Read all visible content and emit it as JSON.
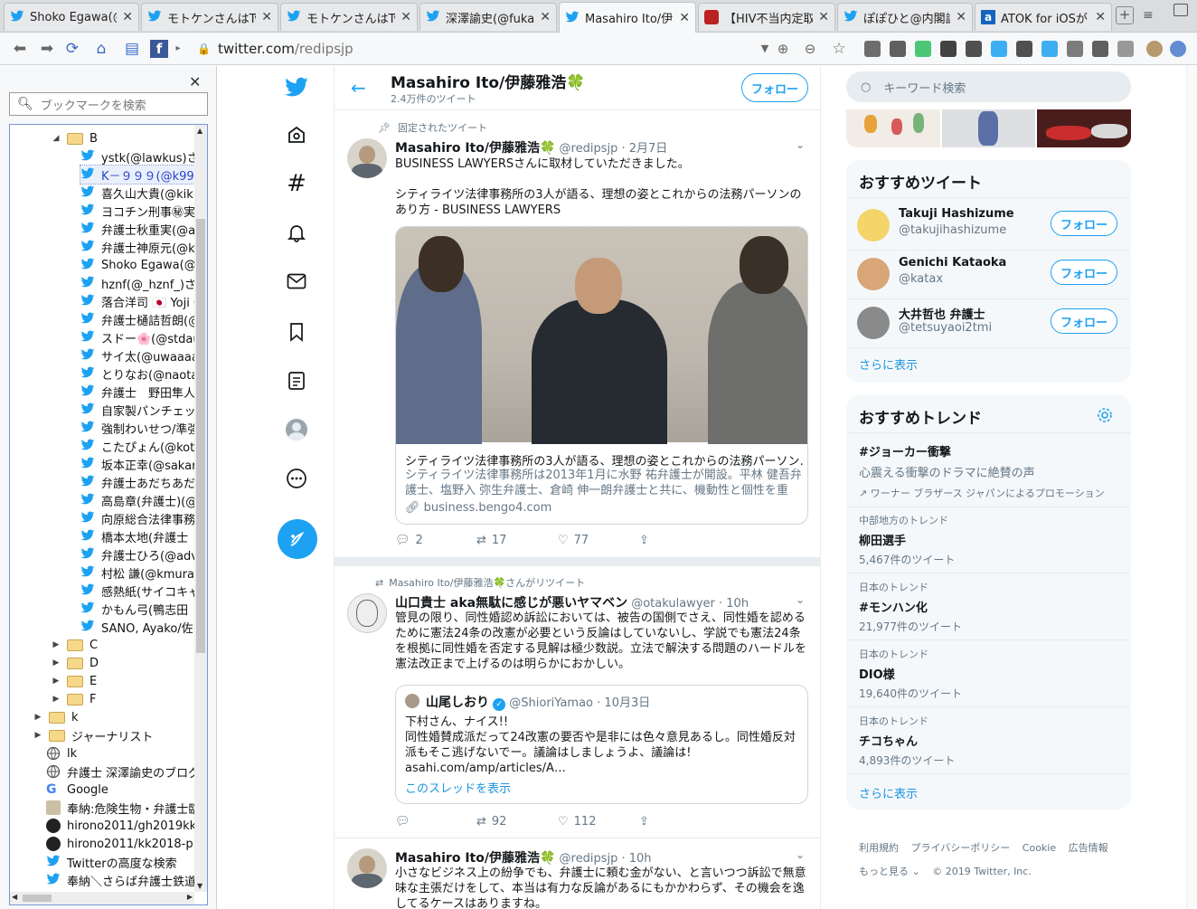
{
  "tabs": [
    {
      "title": "Shoko Egawa(@",
      "icon": "twitter-icon",
      "active": false
    },
    {
      "title": "モトケンさんはTw",
      "icon": "twitter-icon",
      "active": false
    },
    {
      "title": "モトケンさんはTw",
      "icon": "twitter-icon",
      "active": false
    },
    {
      "title": "深澤諭史(@fuka",
      "icon": "twitter-icon",
      "active": false
    },
    {
      "title": "Masahiro Ito/伊",
      "icon": "twitter-icon",
      "active": true
    },
    {
      "title": "【HIV不当内定取",
      "icon": "page-icon",
      "active": false
    },
    {
      "title": "ぽぽひと@内閣訴",
      "icon": "twitter-icon",
      "active": false
    },
    {
      "title": "ATOK for iOSが",
      "icon": "a-icon",
      "active": false
    }
  ],
  "address": {
    "host": "twitter.com",
    "path": "/redipsjp"
  },
  "sidebar": {
    "search_placeholder": "ブックマークを検索",
    "items": [
      {
        "label": "B",
        "type": "folder",
        "depth": 2,
        "open": true
      },
      {
        "label": "ystk(@lawkus)さん",
        "type": "bird",
        "depth": 3
      },
      {
        "label": "K－９９９(@k99",
        "type": "bird",
        "depth": 3,
        "selected": true
      },
      {
        "label": "喜久山大貴(@kik",
        "type": "bird",
        "depth": 3
      },
      {
        "label": "ヨコチン刑事㊙実录",
        "type": "bird",
        "depth": 3
      },
      {
        "label": "弁護士秋重実(@a",
        "type": "bird",
        "depth": 3
      },
      {
        "label": "弁護士神原元(@k",
        "type": "bird",
        "depth": 3
      },
      {
        "label": "Shoko Egawa(@",
        "type": "bird",
        "depth": 3
      },
      {
        "label": "hznf(@_hznf_)さん",
        "type": "bird",
        "depth": 3
      },
      {
        "label": "落合洋司 🇯🇵 Yoji O",
        "type": "bird",
        "depth": 3
      },
      {
        "label": "弁護士樋詰哲朗(@",
        "type": "bird",
        "depth": 3
      },
      {
        "label": "スドー🌸(@stdau",
        "type": "bird",
        "depth": 3
      },
      {
        "label": "サイ太(@uwaaaa)",
        "type": "bird",
        "depth": 3
      },
      {
        "label": "とりなお(@naotar",
        "type": "bird",
        "depth": 3
      },
      {
        "label": "弁護士　野田隼人",
        "type": "bird",
        "depth": 3
      },
      {
        "label": "自家製パンチェック",
        "type": "bird",
        "depth": 3
      },
      {
        "label": "強制わいせつ/準強",
        "type": "bird",
        "depth": 3
      },
      {
        "label": "こたぴょん(@kota",
        "type": "bird",
        "depth": 3
      },
      {
        "label": "坂本正幸(@sakar",
        "type": "bird",
        "depth": 3
      },
      {
        "label": "弁護士あだちあだ",
        "type": "bird",
        "depth": 3
      },
      {
        "label": "高島章(弁護士)(@",
        "type": "bird",
        "depth": 3
      },
      {
        "label": "向原総合法律事務",
        "type": "bird",
        "depth": 3
      },
      {
        "label": "橋本太地(弁護士",
        "type": "bird",
        "depth": 3
      },
      {
        "label": "弁護士ひろ(@adv",
        "type": "bird",
        "depth": 3
      },
      {
        "label": "村松 謙(@kmurar",
        "type": "bird",
        "depth": 3
      },
      {
        "label": "感熱紙(サイコキャ",
        "type": "bird",
        "depth": 3
      },
      {
        "label": "かもん弓(鴨志田",
        "type": "bird",
        "depth": 3
      },
      {
        "label": "SANO, Ayako/佐",
        "type": "bird",
        "depth": 3
      },
      {
        "label": "C",
        "type": "folder",
        "depth": 2
      },
      {
        "label": "D",
        "type": "folder",
        "depth": 2
      },
      {
        "label": "E",
        "type": "folder",
        "depth": 2
      },
      {
        "label": "F",
        "type": "folder",
        "depth": 2
      },
      {
        "label": "k",
        "type": "folder",
        "depth": 1
      },
      {
        "label": "ジャーナリスト",
        "type": "folder",
        "depth": 1
      },
      {
        "label": "lk",
        "type": "globe",
        "depth": 1
      },
      {
        "label": "弁護士 深澤諭史のブログ",
        "type": "globe",
        "depth": 1
      },
      {
        "label": "Google",
        "type": "google",
        "depth": 1
      },
      {
        "label": "奉納:危険生物・弁護士臨",
        "type": "page",
        "depth": 1
      },
      {
        "label": "hirono2011/gh2019kk",
        "type": "github",
        "depth": 1
      },
      {
        "label": "hirono2011/kk2018-p",
        "type": "github",
        "depth": 1
      },
      {
        "label": "Twitterの高度な検索",
        "type": "bird",
        "depth": 1
      },
      {
        "label": "奉納＼さらば弁護士鉄道",
        "type": "bird",
        "depth": 1
      }
    ]
  },
  "profile_header": {
    "name": "Masahiro Ito/伊藤雅浩🍀",
    "tweet_count": "2.4万件のツイート",
    "follow_label": "フォロー"
  },
  "tweets": [
    {
      "pinned_label": "固定されたツイート",
      "name": "Masahiro Ito/伊藤雅浩🍀",
      "handle": "@redipsjp",
      "time": "2月7日",
      "text1": "BUSINESS LAWYERSさんに取材していただきました。",
      "text2": "シティライツ法律事務所の3人が語る、理想の姿とこれからの法務パーソンのあり方 - BUSINESS LAWYERS",
      "card_title": "シティライツ法律事務所の3人が語る、理想の姿とこれからの法務パーソン…",
      "card_desc": "シティライツ法律事務所は2013年1月に水野 祐弁護士が開設。平林 健吾弁護士、塩野入 弥生弁護士、倉崎 伸一朗弁護士と共に、機動性と個性を重視…",
      "card_domain": "business.bengo4.com",
      "replies": "2",
      "retweets": "17",
      "likes": "77"
    },
    {
      "retweeted_label": "Masahiro Ito/伊藤雅浩🍀さんがリツイート",
      "name": "山口貴士 aka無駄に感じが悪いヤマベン",
      "handle": "@otakulawyer",
      "time": "10h",
      "text": "管見の限り、同性婚認め訴訟においては、被告の国側でさえ、同性婚を認めるために憲法24条の改憲が必要という反論はしていないし、学説でも憲法24条を根拠に同性婚を否定する見解は極少数説。立法で解決する問題のハードルを憲法改正まで上げるのは明らかにおかしい。",
      "quote": {
        "name": "山尾しおり",
        "handle": "@ShioriYamao",
        "time": "10月3日",
        "text": "下村さん、ナイス!!\n同性婚賛成派だって24改憲の要否や是非には色々意見あるし。同性婚反対派もそこ逃げないでー。議論はしましょうよ、議論は!\nasahi.com/amp/articles/A…",
        "thread_link": "このスレッドを表示"
      },
      "replies": "",
      "retweets": "92",
      "likes": "112"
    },
    {
      "name": "Masahiro Ito/伊藤雅浩🍀",
      "handle": "@redipsjp",
      "time": "10h",
      "text": "小さなビジネス上の紛争でも、弁護士に頼む金がない、と言いつつ訴訟で無意味な主張だけをして、本当は有力な反論があるにもかかわらず、その機会を逸してるケースはありますね。"
    }
  ],
  "right": {
    "search_placeholder": "キーワード検索",
    "whotofollow_title": "おすすめツイート",
    "users": [
      {
        "name": "Takuji Hashizume",
        "handle": "@takujihashizume",
        "follow": "フォロー"
      },
      {
        "name": "Genichi Kataoka",
        "handle": "@katax",
        "follow": "フォロー"
      },
      {
        "name": "大井哲也 弁護士",
        "handle": "@tetsuyaoi2tmi",
        "follow": "フォロー"
      }
    ],
    "show_more": "さらに表示",
    "trends_title": "おすすめトレンド",
    "promo": {
      "name": "#ジョーカー衝撃",
      "desc": "心震える衝撃のドラマに絶賛の声",
      "by": "ワーナー ブラザース ジャパンによるプロモーション"
    },
    "trends": [
      {
        "cat": "中部地方のトレンド",
        "name": "柳田選手",
        "count": "5,467件のツイート"
      },
      {
        "cat": "日本のトレンド",
        "name": "#モンハン化",
        "count": "21,977件のツイート"
      },
      {
        "cat": "日本のトレンド",
        "name": "DIO様",
        "count": "19,640件のツイート"
      },
      {
        "cat": "日本のトレンド",
        "name": "チコちゃん",
        "count": "4,893件のツイート"
      }
    ],
    "trends_more": "さらに表示",
    "footer": {
      "terms": "利用規約",
      "privacy": "プライバシーポリシー",
      "cookie": "Cookie",
      "ads": "広告情報",
      "more": "もっと見る",
      "copy": "© 2019 Twitter, Inc."
    }
  },
  "colors": {
    "brand": "#1da1f2",
    "link": "#1b95e0",
    "text": "#14171a",
    "muted": "#657786"
  }
}
